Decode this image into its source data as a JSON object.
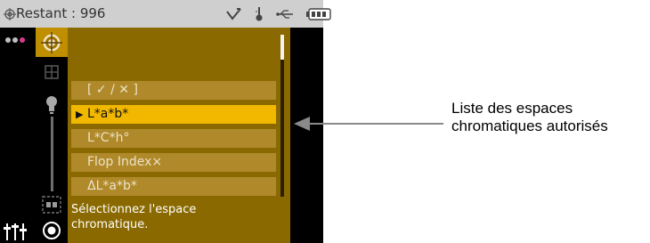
{
  "status_bar": {
    "target_icon": "crosshair-icon",
    "remaining_text": "Restant : 996",
    "icons": [
      "checkmark-signal-icon",
      "thermometer-icon",
      "usb-icon",
      "battery-icon"
    ]
  },
  "sidebar": {
    "top_icon": "dots-icon",
    "bottom_icon": "sliders-icon"
  },
  "tabs": [
    {
      "icon": "crosshair-target-icon",
      "active": true
    },
    {
      "icon": "grid-icon",
      "active": false
    },
    {
      "icon": "bulb-icon",
      "active": false
    },
    {
      "icon": "frame-icon",
      "active": false
    },
    {
      "icon": "disc-icon",
      "active": false
    }
  ],
  "list": {
    "items": [
      {
        "label": "[ ✓ / ✕ ]",
        "selected": false
      },
      {
        "label": "L*a*b*",
        "selected": true
      },
      {
        "label": "L*C*h°",
        "selected": false
      },
      {
        "label": "Flop Index",
        "suffix": "×",
        "selected": false
      },
      {
        "label": "ΔL*a*b*",
        "selected": false
      }
    ],
    "selected_marker": "▶"
  },
  "message": {
    "line1": "Sélectionnez l'espace",
    "line2": "chromatique."
  },
  "colors": {
    "content_bg": "#8a6a00",
    "item_bg": "#b08a2a",
    "selected_bg": "#f2b800",
    "accent": "#c08f00"
  },
  "callout": {
    "line1": "Liste des espaces",
    "line2": "chromatiques autorisés"
  }
}
